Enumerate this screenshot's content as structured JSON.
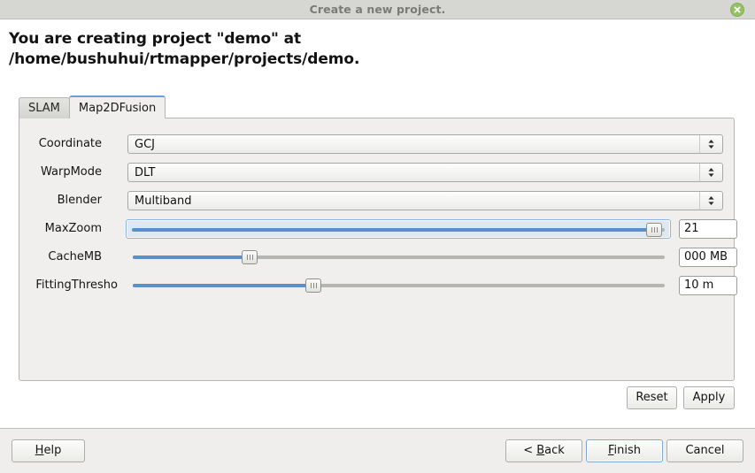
{
  "window": {
    "title": "Create a new project.",
    "close_icon": "close-circle-icon",
    "accent_color": "#5b8fcb",
    "close_button_color": "#94c162",
    "titlebar_color": "#d6d6d3",
    "panel_color": "#f0efed"
  },
  "heading": {
    "line1": "You are creating project \"demo\" at",
    "line2": "/home/bushuhui/rtmapper/projects/demo."
  },
  "tabs": [
    {
      "label": "SLAM",
      "active": false
    },
    {
      "label": "Map2DFusion",
      "active": true
    }
  ],
  "form": {
    "rows": [
      {
        "label": "Coordinate",
        "type": "combo",
        "value": "GCJ",
        "arrow_icon": "chevron-up-down-icon"
      },
      {
        "label": "WarpMode",
        "type": "combo",
        "value": "DLT",
        "arrow_icon": "chevron-up-down-icon"
      },
      {
        "label": "Blender",
        "type": "combo",
        "value": "Multiband",
        "arrow_icon": "chevron-up-down-icon"
      },
      {
        "label": "MaxZoom",
        "type": "slider",
        "percent": 98,
        "focused": true,
        "spin_value": "21"
      },
      {
        "label": "CacheMB",
        "type": "slider",
        "percent": 22,
        "focused": false,
        "spin_value": "000 MB"
      },
      {
        "label": "FittingThresho",
        "type": "slider",
        "percent": 34,
        "focused": false,
        "spin_value": "10 m"
      }
    ]
  },
  "panel_buttons": {
    "reset": "Reset",
    "apply": "Apply"
  },
  "footer": {
    "help": "Help",
    "help_mnemonic": "H",
    "back": "< Back",
    "back_mnemonic": "B",
    "finish": "Finish",
    "finish_mnemonic": "F",
    "cancel": "Cancel"
  }
}
